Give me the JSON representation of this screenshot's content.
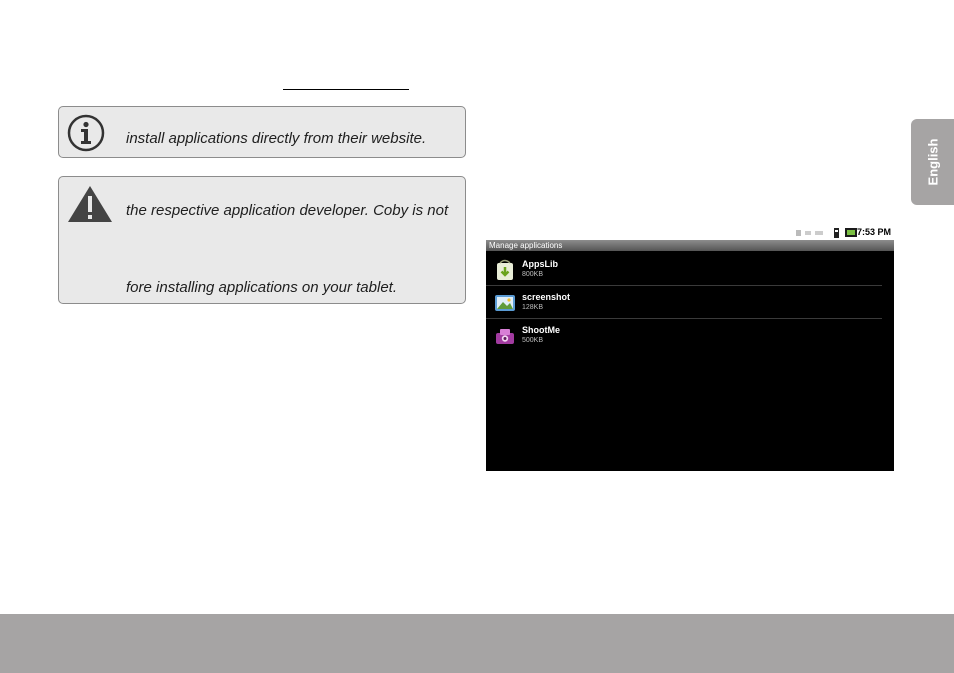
{
  "note_box": {
    "icon": "info-icon",
    "line": "install applications directly from their website."
  },
  "warning_box": {
    "icon": "warning-icon",
    "lines": [
      "the respective application developer. Coby is not",
      "fore installing applications on your tablet."
    ]
  },
  "side_tab": {
    "label": "English"
  },
  "screenshot": {
    "status_time": "7:53 PM",
    "title": "Manage applications",
    "apps": [
      {
        "name": "AppsLib",
        "size": "800KB",
        "icon": "appslib-icon"
      },
      {
        "name": "screenshot",
        "size": "128KB",
        "icon": "screenshot-app-icon"
      },
      {
        "name": "ShootMe",
        "size": "500KB",
        "icon": "shootme-icon"
      }
    ]
  },
  "colors": {
    "box_background": "#e9e9e9",
    "box_border": "#8c8c8c",
    "tab_and_footer": "#a6a4a4"
  }
}
